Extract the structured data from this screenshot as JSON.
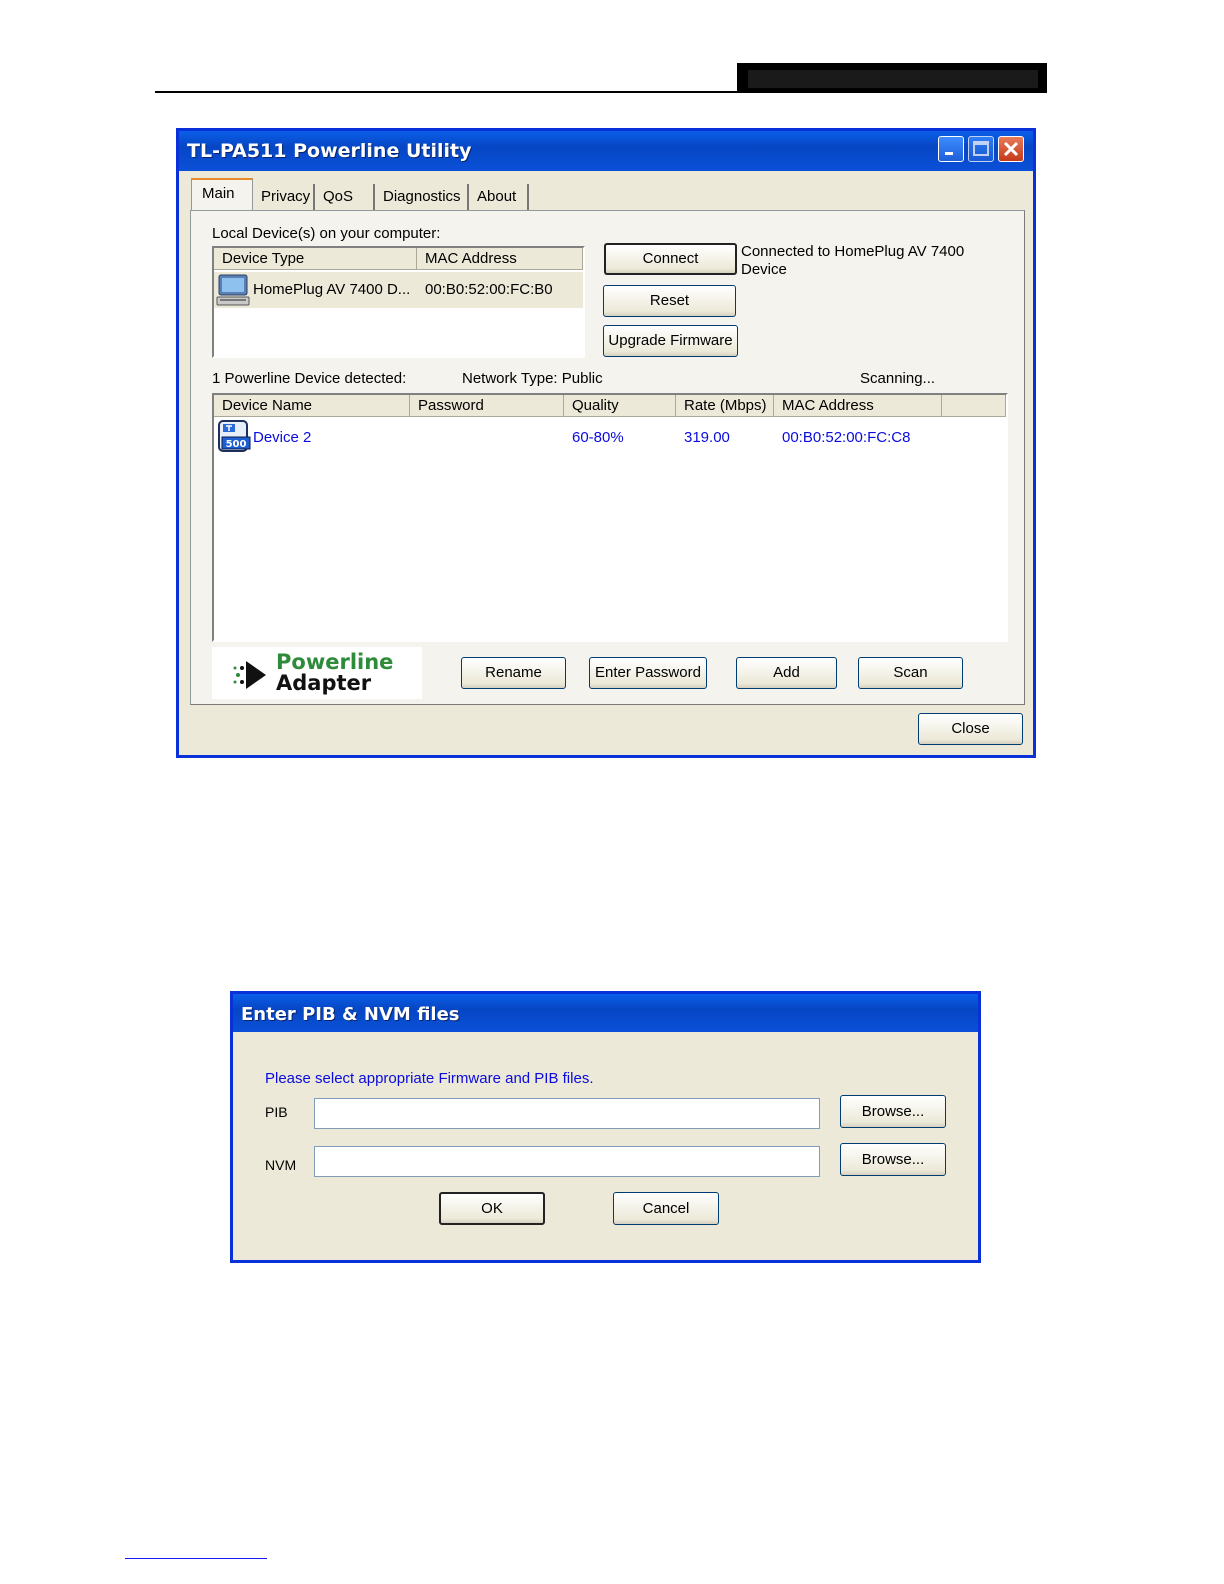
{
  "utility": {
    "title": "TL-PA511 Powerline Utility",
    "tabs": [
      "Main",
      "Privacy",
      "QoS",
      "Diagnostics",
      "About"
    ],
    "local_label": "Local Device(s) on your computer:",
    "local_columns": [
      "Device Type",
      "MAC Address"
    ],
    "local_row": {
      "type": "HomePlug AV 7400 D...",
      "mac": "00:B0:52:00:FC:B0"
    },
    "connect_label": "Connect",
    "reset_label": "Reset",
    "upgrade_label": "Upgrade Firmware",
    "status_line1": "Connected to HomePlug AV 7400",
    "status_line2": "Device",
    "detected_label": "1 Powerline Device detected:",
    "network_type": "Network Type: Public",
    "scanning": "Scanning...",
    "remote_columns": [
      "Device Name",
      "Password",
      "Quality",
      "Rate (Mbps)",
      "MAC Address"
    ],
    "remote_row": {
      "name": "Device 2",
      "password": "",
      "quality": "60-80%",
      "rate": "319.00",
      "mac": "00:B0:52:00:FC:C8"
    },
    "logo_line1": "Powerline",
    "logo_line2": "Adapter",
    "rename_label": "Rename",
    "enter_password_label": "Enter Password",
    "add_label": "Add",
    "scan_label": "Scan",
    "close_label": "Close"
  },
  "pib_dialog": {
    "title": "Enter PIB & NVM files",
    "instruction": "Please select appropriate Firmware and PIB files.",
    "pib_label": "PIB",
    "nvm_label": "NVM",
    "pib_value": "",
    "nvm_value": "",
    "browse_label": "Browse...",
    "ok_label": "OK",
    "cancel_label": "Cancel"
  },
  "colors": {
    "xp_blue": "#0831d9",
    "link_blue": "#0b0bdd",
    "logo_green": "#2e8b3a"
  }
}
